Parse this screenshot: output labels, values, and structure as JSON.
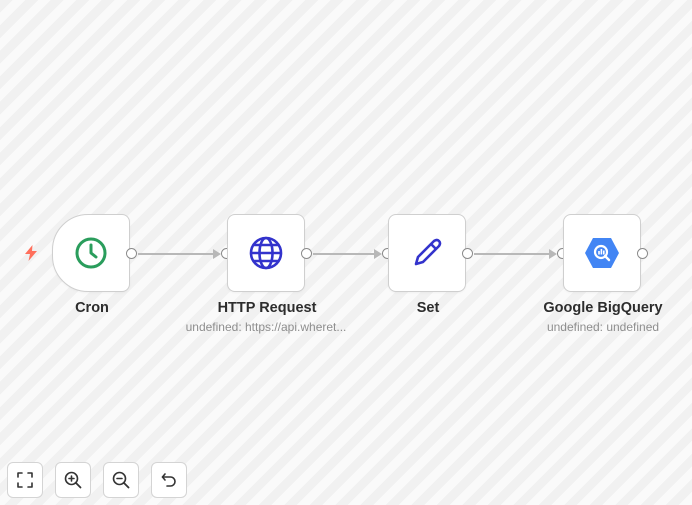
{
  "nodes": [
    {
      "id": "cron",
      "label": "Cron",
      "sublabel": "",
      "icon": "clock-icon",
      "color": "#2a9d5c"
    },
    {
      "id": "http",
      "label": "HTTP Request",
      "sublabel": "undefined: https://api.wheret...",
      "icon": "globe-icon",
      "color": "#3333cc"
    },
    {
      "id": "set",
      "label": "Set",
      "sublabel": "",
      "icon": "pencil-icon",
      "color": "#3333cc"
    },
    {
      "id": "bigquery",
      "label": "Google BigQuery",
      "sublabel": "undefined: undefined",
      "icon": "bigquery-icon",
      "color": "#4285f4"
    }
  ],
  "colors": {
    "trigger_bolt": "#ff6f5c",
    "edge": "#b8b8b8",
    "handle_border": "#8a8a8a"
  },
  "controls": [
    {
      "name": "fit-view-button",
      "icon": "fullscreen-icon"
    },
    {
      "name": "zoom-in-button",
      "icon": "zoom-in-icon"
    },
    {
      "name": "zoom-out-button",
      "icon": "zoom-out-icon"
    },
    {
      "name": "reset-zoom-button",
      "icon": "undo-icon"
    }
  ]
}
